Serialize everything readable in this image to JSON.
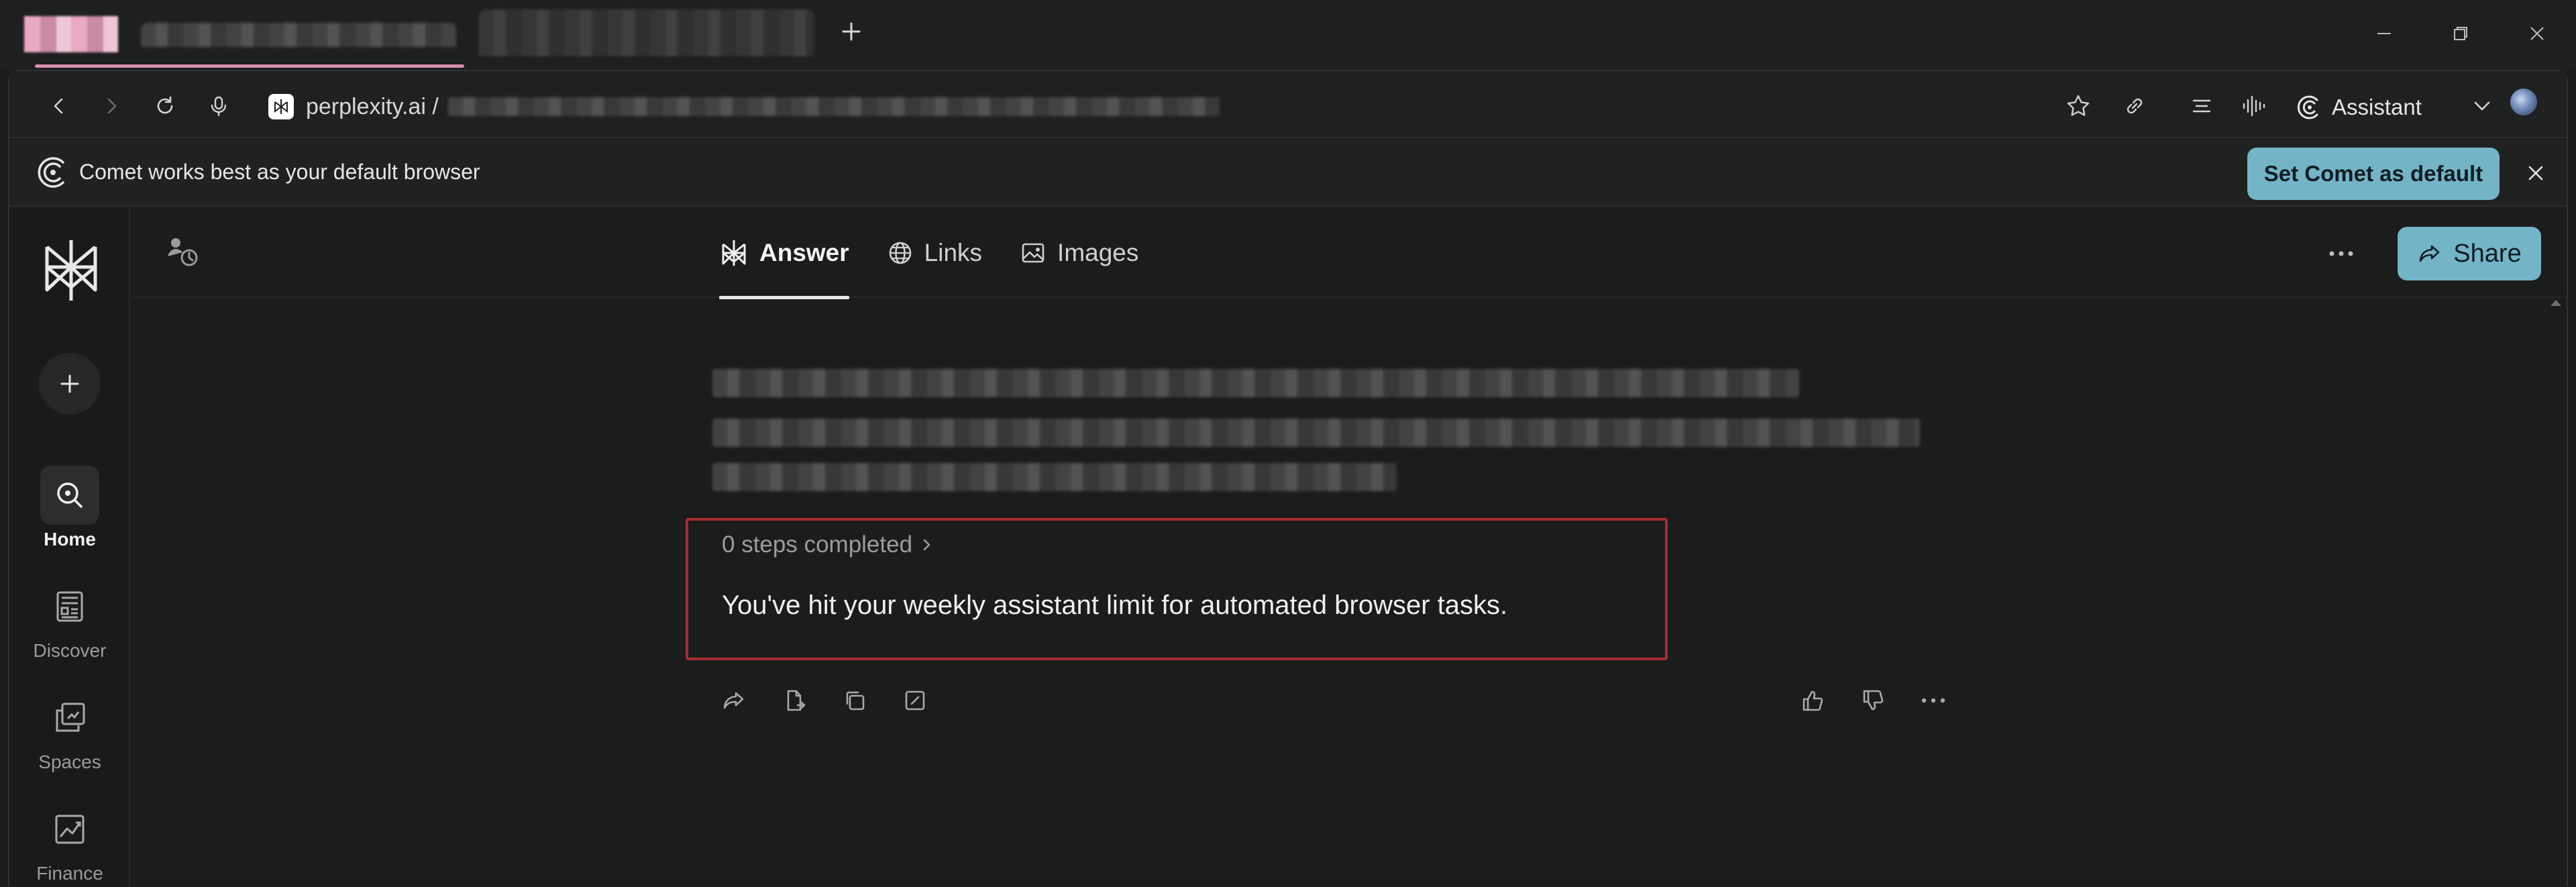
{
  "address_bar": {
    "url_domain": "perplexity.ai /"
  },
  "toolbar": {
    "assistant_label": "Assistant"
  },
  "banner": {
    "message": "Comet works best as your default browser",
    "set_default_label": "Set Comet as default"
  },
  "sidebar": {
    "items": [
      {
        "label": "Home",
        "icon": "home-search-icon"
      },
      {
        "label": "Discover",
        "icon": "discover-icon"
      },
      {
        "label": "Spaces",
        "icon": "spaces-icon"
      },
      {
        "label": "Finance",
        "icon": "finance-icon"
      }
    ]
  },
  "content_tabs": [
    {
      "label": "Answer"
    },
    {
      "label": "Links"
    },
    {
      "label": "Images"
    }
  ],
  "share_label": "Share",
  "result": {
    "steps": "0 steps completed",
    "message": "You've hit your weekly assistant limit for automated browser tasks."
  },
  "colors": {
    "accent": "#73b4c7",
    "highlight_border": "#a52d31",
    "background": "#1b1c1c"
  }
}
